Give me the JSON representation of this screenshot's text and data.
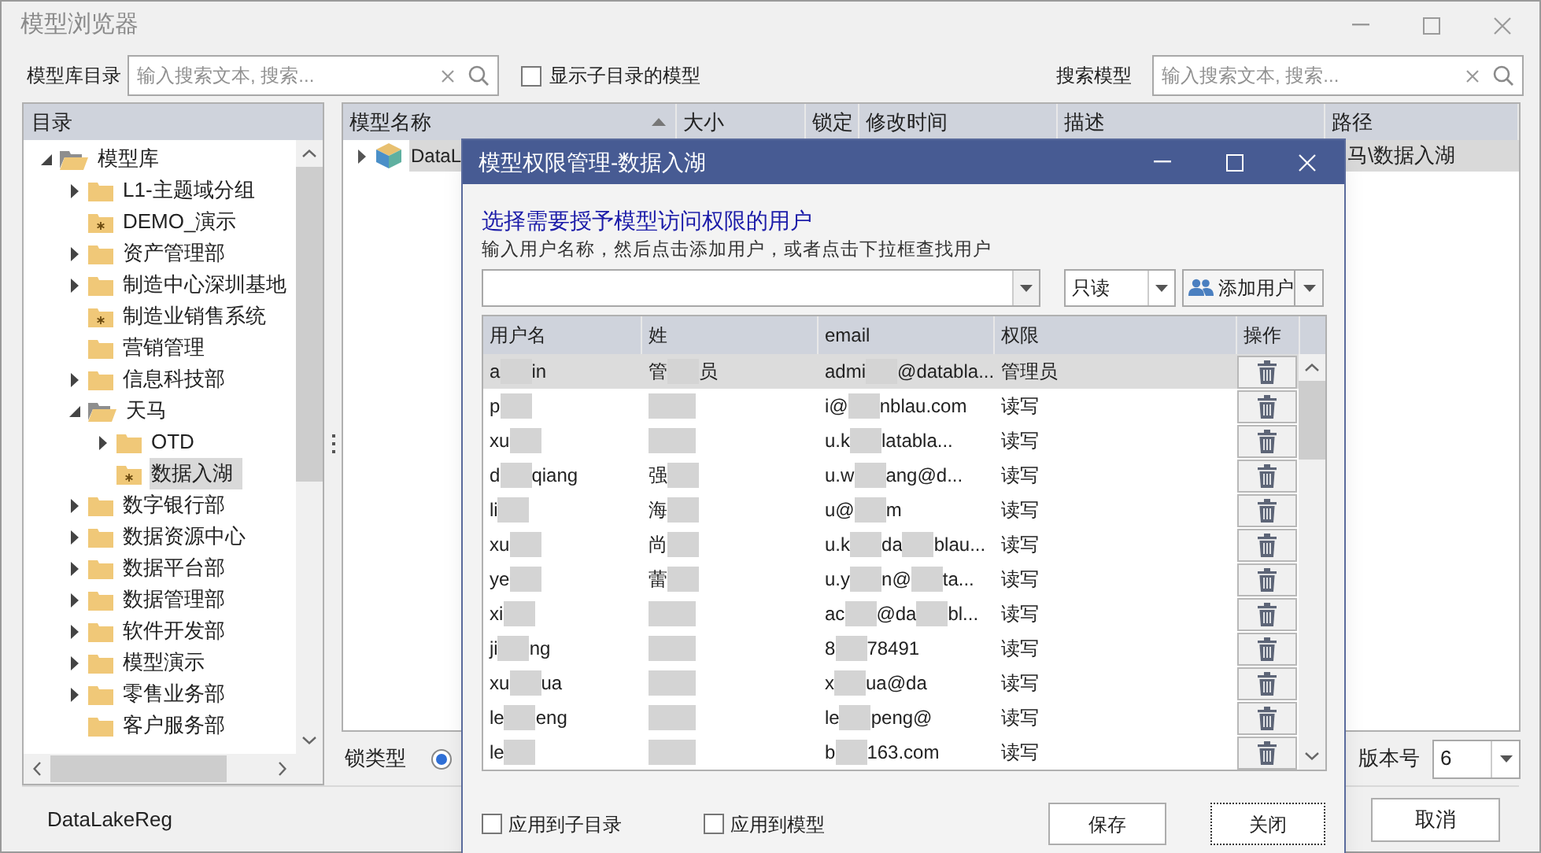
{
  "window": {
    "title": "模型浏览器"
  },
  "toolbar": {
    "library_label": "模型库目录",
    "library_search": {
      "placeholder": "输入搜索文本, 搜索..."
    },
    "show_sub": {
      "label": "显示子目录的模型",
      "checked": false
    },
    "model_label": "搜索模型",
    "model_search": {
      "placeholder": "输入搜索文本, 搜索..."
    }
  },
  "tree": {
    "header": "目录",
    "items": [
      {
        "label": "模型库",
        "kind": "folder",
        "expanded": true,
        "selected": false,
        "children": [
          {
            "label": "L1-主题域分组",
            "kind": "folder",
            "expanded": false,
            "selected": false
          },
          {
            "label": "DEMO_演示",
            "kind": "model",
            "selected": false
          },
          {
            "label": "资产管理部",
            "kind": "folder",
            "expanded": false,
            "selected": false
          },
          {
            "label": "制造中心深圳基地",
            "kind": "folder",
            "expanded": false,
            "selected": false
          },
          {
            "label": "制造业销售系统",
            "kind": "model",
            "selected": false
          },
          {
            "label": "营销管理",
            "kind": "folder",
            "selected": false
          },
          {
            "label": "信息科技部",
            "kind": "folder",
            "expanded": false,
            "selected": false
          },
          {
            "label": "天马",
            "kind": "folder",
            "expanded": true,
            "selected": false,
            "children": [
              {
                "label": "OTD",
                "kind": "folder",
                "expanded": false,
                "selected": false
              },
              {
                "label": "数据入湖",
                "kind": "model",
                "selected": true
              }
            ]
          },
          {
            "label": "数字银行部",
            "kind": "folder",
            "expanded": false,
            "selected": false
          },
          {
            "label": "数据资源中心",
            "kind": "folder",
            "expanded": false,
            "selected": false
          },
          {
            "label": "数据平台部",
            "kind": "folder",
            "expanded": false,
            "selected": false
          },
          {
            "label": "数据管理部",
            "kind": "folder",
            "expanded": false,
            "selected": false
          },
          {
            "label": "软件开发部",
            "kind": "folder",
            "expanded": false,
            "selected": false
          },
          {
            "label": "模型演示",
            "kind": "folder",
            "expanded": false,
            "selected": false
          },
          {
            "label": "零售业务部",
            "kind": "folder",
            "expanded": false,
            "selected": false
          },
          {
            "label": "客户服务部",
            "kind": "folder",
            "selected": false
          }
        ]
      }
    ]
  },
  "models": {
    "columns": [
      "模型名称",
      "大小",
      "锁定",
      "修改时间",
      "描述",
      "路径"
    ],
    "rows": [
      {
        "name": "DataL",
        "path": "马\\数据入湖",
        "selected": true
      }
    ]
  },
  "lock_type": {
    "label": "锁类型",
    "selected": true
  },
  "version": {
    "label": "版本号",
    "value": "6"
  },
  "status": "DataLakeReg",
  "cancel_button": "取消",
  "dialog": {
    "title": "模型权限管理-数据入湖",
    "heading": "选择需要授予模型访问权限的用户",
    "hint": "输入用户名称，然后点击添加用户，或者点击下拉框查找用户",
    "permission": "只读",
    "add_button": "添加用户",
    "columns": [
      "用户名",
      "姓",
      "email",
      "权限",
      "操作"
    ],
    "rows": [
      {
        "user": [
          "a",
          "in"
        ],
        "name": [
          "管",
          "员"
        ],
        "email": [
          "admi",
          "@databla..."
        ],
        "permission": "管理员",
        "selected": true
      },
      {
        "user": [
          "p"
        ],
        "email": [
          "i@",
          "nblau.com"
        ],
        "permission": "读写",
        "selected": false
      },
      {
        "user": [
          "xu"
        ],
        "email": [
          "u.k",
          "latabla..."
        ],
        "permission": "读写",
        "selected": false
      },
      {
        "user": [
          "d",
          "qiang"
        ],
        "name": [
          "强"
        ],
        "email": [
          "u.w",
          "ang@d..."
        ],
        "permission": "读写",
        "selected": false
      },
      {
        "user": [
          "li"
        ],
        "name": [
          "海"
        ],
        "email": [
          "u@",
          "m"
        ],
        "permission": "读写",
        "selected": false
      },
      {
        "user": [
          "xu"
        ],
        "name": [
          "尚"
        ],
        "email": [
          "u.k",
          "da",
          "blau..."
        ],
        "permission": "读写",
        "selected": false
      },
      {
        "user": [
          "ye"
        ],
        "name": [
          "蕾"
        ],
        "email": [
          "u.y",
          "n@",
          "ta..."
        ],
        "permission": "读写",
        "selected": false
      },
      {
        "user": [
          "xi"
        ],
        "email": [
          "ac",
          "@da",
          "bl..."
        ],
        "permission": "读写",
        "selected": false
      },
      {
        "user": [
          "ji",
          "ng"
        ],
        "email": [
          "8",
          "78491"
        ],
        "permission": "读写",
        "selected": false
      },
      {
        "user": [
          "xu",
          "ua"
        ],
        "email": [
          "x",
          "ua@da"
        ],
        "permission": "读写",
        "selected": false
      },
      {
        "user": [
          "le",
          "eng"
        ],
        "email": [
          "le",
          "peng@"
        ],
        "permission": "读写",
        "selected": false
      },
      {
        "user": [
          "le"
        ],
        "email": [
          "b",
          "163.com"
        ],
        "permission": "读写",
        "selected": false
      }
    ],
    "apply_subdirs": {
      "label": "应用到子目录",
      "checked": false
    },
    "apply_models": {
      "label": "应用到模型",
      "checked": false
    },
    "save_button": "保存",
    "close_button": "关闭"
  }
}
